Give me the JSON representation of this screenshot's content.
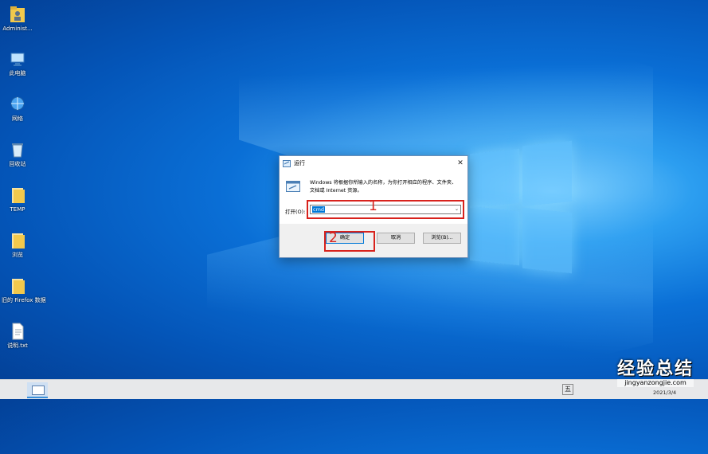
{
  "desktop": {
    "icons": [
      {
        "label": "Administ...",
        "icon": "user-folder-icon"
      },
      {
        "label": "此电脑",
        "icon": "this-pc-icon"
      },
      {
        "label": "网络",
        "icon": "network-icon"
      },
      {
        "label": "回收站",
        "icon": "recycle-bin-icon"
      },
      {
        "label": "TEMP",
        "icon": "folder-icon"
      },
      {
        "label": "浏览",
        "icon": "folder-icon"
      },
      {
        "label": "旧的 Firefox 数据",
        "icon": "folder-icon"
      },
      {
        "label": "说明.txt",
        "icon": "text-file-icon"
      }
    ]
  },
  "run_dialog": {
    "title": "运行",
    "description": "Windows 将根据你所输入的名称，为你打开相应的程序、文件夹、文档或 Internet 资源。",
    "open_label": "打开(O):",
    "open_value": "cmd",
    "ok_label": "确定",
    "cancel_label": "取消",
    "browse_label": "浏览(B)...",
    "close_glyph": "✕"
  },
  "annotations": {
    "step1": "1",
    "step2": "2",
    "color": "#d8221c"
  },
  "taskbar": {
    "ime": "五",
    "date": "2021/3/4"
  },
  "watermark": {
    "title": "经验总结",
    "url": "jingyanzongjie.com"
  }
}
